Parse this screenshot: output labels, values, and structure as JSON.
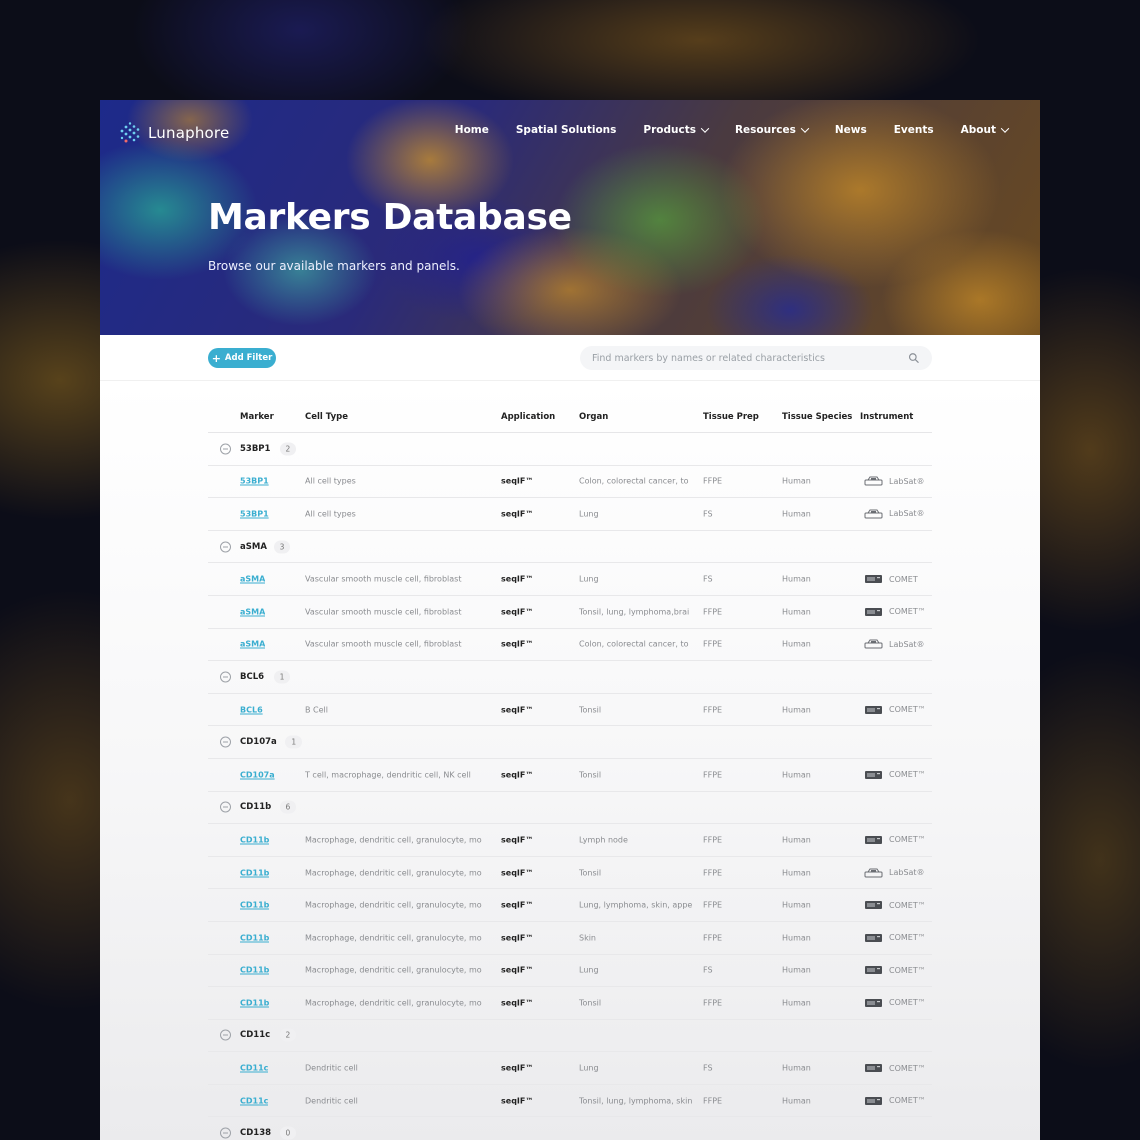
{
  "brand": {
    "name": "Lunaphore"
  },
  "nav": [
    {
      "label": "Home",
      "dropdown": false
    },
    {
      "label": "Spatial Solutions",
      "dropdown": false
    },
    {
      "label": "Products",
      "dropdown": true
    },
    {
      "label": "Resources",
      "dropdown": true
    },
    {
      "label": "News",
      "dropdown": false
    },
    {
      "label": "Events",
      "dropdown": false
    },
    {
      "label": "About",
      "dropdown": true
    }
  ],
  "hero": {
    "title": "Markers Database",
    "subtitle": "Browse our available markers and panels."
  },
  "toolbar": {
    "add_filter_label": "Add Filter",
    "search_placeholder": "Find markers by names or related characteristics"
  },
  "colors": {
    "accent": "#3aaed0",
    "text_dark": "#222222",
    "text_muted": "#8a8c90"
  },
  "table": {
    "headers": {
      "marker": "Marker",
      "cell_type": "Cell Type",
      "application": "Application",
      "organ": "Organ",
      "tissue_prep": "Tissue Prep",
      "tissue_species": "Tissue Species",
      "instrument": "Instrument"
    },
    "groups": [
      {
        "name": "53BP1",
        "count": "2",
        "rows": [
          {
            "marker": "53BP1",
            "cell_type": "All cell types",
            "application": "seqIF™",
            "organ": "Colon, colorectal cancer, to",
            "prep": "FFPE",
            "species": "Human",
            "instrument": "LabSat®",
            "icon": "labsat-icon"
          },
          {
            "marker": "53BP1",
            "cell_type": "All cell types",
            "application": "seqIF™",
            "organ": "Lung",
            "prep": "FS",
            "species": "Human",
            "instrument": "LabSat®",
            "icon": "labsat-icon"
          }
        ]
      },
      {
        "name": "aSMA",
        "count": "3",
        "rows": [
          {
            "marker": "aSMA",
            "cell_type": "Vascular smooth muscle cell, fibroblast",
            "application": "seqIF™",
            "organ": "Lung",
            "prep": "FS",
            "species": "Human",
            "instrument": "COMET",
            "icon": "comet-icon"
          },
          {
            "marker": "aSMA",
            "cell_type": "Vascular smooth muscle cell, fibroblast",
            "application": "seqIF™",
            "organ": "Tonsil, lung, lymphoma,brai",
            "prep": "FFPE",
            "species": "Human",
            "instrument": "COMET™",
            "icon": "comet-icon"
          },
          {
            "marker": "aSMA",
            "cell_type": "Vascular smooth muscle cell, fibroblast",
            "application": "seqIF™",
            "organ": "Colon, colorectal cancer, to",
            "prep": "FFPE",
            "species": "Human",
            "instrument": "LabSat®",
            "icon": "labsat-icon"
          }
        ]
      },
      {
        "name": "BCL6",
        "count": "1",
        "rows": [
          {
            "marker": "BCL6",
            "cell_type": "B Cell",
            "application": "seqIF™",
            "organ": "Tonsil",
            "prep": "FFPE",
            "species": "Human",
            "instrument": "COMET™",
            "icon": "comet-icon"
          }
        ]
      },
      {
        "name": "CD107a",
        "count": "1",
        "rows": [
          {
            "marker": "CD107a",
            "cell_type": "T cell, macrophage, dendritic cell, NK cell",
            "application": "seqIF™",
            "organ": "Tonsil",
            "prep": "FFPE",
            "species": "Human",
            "instrument": "COMET™",
            "icon": "comet-icon"
          }
        ]
      },
      {
        "name": "CD11b",
        "count": "6",
        "rows": [
          {
            "marker": "CD11b",
            "cell_type": "Macrophage, dendritic cell, granulocyte, mo",
            "application": "seqIF™",
            "organ": "Lymph node",
            "prep": "FFPE",
            "species": "Human",
            "instrument": "COMET™",
            "icon": "comet-icon"
          },
          {
            "marker": "CD11b",
            "cell_type": "Macrophage, dendritic cell, granulocyte, mo",
            "application": "seqIF™",
            "organ": "Tonsil",
            "prep": "FFPE",
            "species": "Human",
            "instrument": "LabSat®",
            "icon": "labsat-icon"
          },
          {
            "marker": "CD11b",
            "cell_type": "Macrophage, dendritic cell, granulocyte, mo",
            "application": "seqIF™",
            "organ": "Lung, lymphoma, skin, appe",
            "prep": "FFPE",
            "species": "Human",
            "instrument": "COMET™",
            "icon": "comet-icon"
          },
          {
            "marker": "CD11b",
            "cell_type": "Macrophage, dendritic cell, granulocyte, mo",
            "application": "seqIF™",
            "organ": "Skin",
            "prep": "FFPE",
            "species": "Human",
            "instrument": "COMET™",
            "icon": "comet-icon"
          },
          {
            "marker": "CD11b",
            "cell_type": "Macrophage, dendritic cell, granulocyte, mo",
            "application": "seqIF™",
            "organ": "Lung",
            "prep": "FS",
            "species": "Human",
            "instrument": "COMET™",
            "icon": "comet-icon"
          },
          {
            "marker": "CD11b",
            "cell_type": "Macrophage, dendritic cell, granulocyte, mo",
            "application": "seqIF™",
            "organ": "Tonsil",
            "prep": "FFPE",
            "species": "Human",
            "instrument": "COMET™",
            "icon": "comet-icon"
          }
        ]
      },
      {
        "name": "CD11c",
        "count": "2",
        "rows": [
          {
            "marker": "CD11c",
            "cell_type": "Dendritic cell",
            "application": "seqIF™",
            "organ": "Lung",
            "prep": "FS",
            "species": "Human",
            "instrument": "COMET™",
            "icon": "comet-icon"
          },
          {
            "marker": "CD11c",
            "cell_type": "Dendritic cell",
            "application": "seqIF™",
            "organ": "Tonsil, lung, lymphoma, skin",
            "prep": "FFPE",
            "species": "Human",
            "instrument": "COMET™",
            "icon": "comet-icon"
          }
        ]
      },
      {
        "name": "CD138",
        "count": "0",
        "rows": []
      }
    ]
  }
}
